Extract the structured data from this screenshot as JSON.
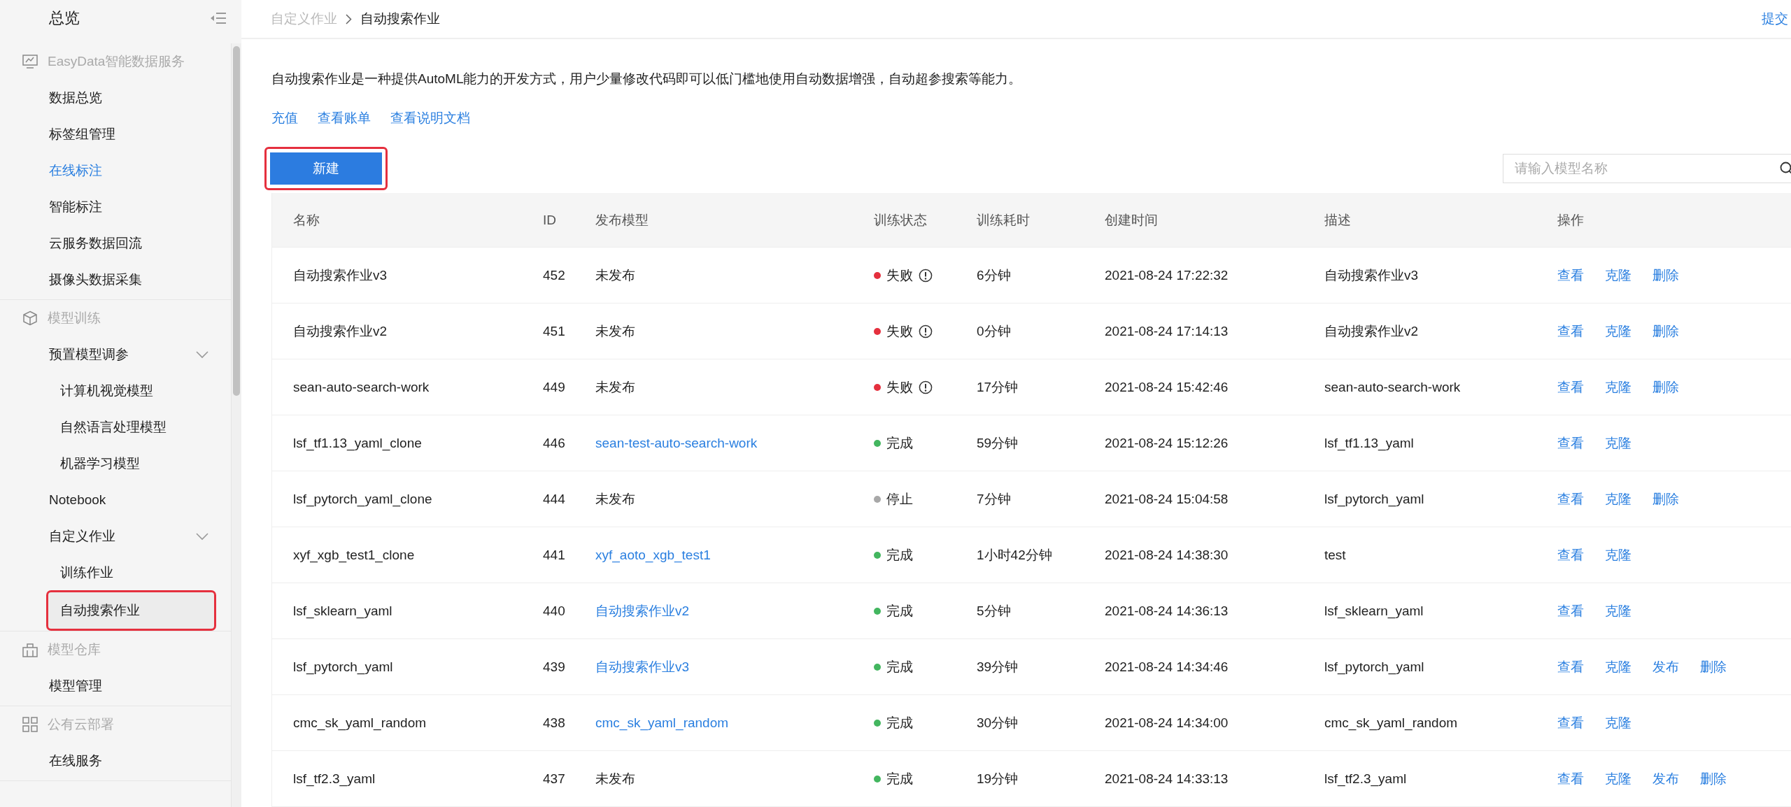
{
  "sidebar": {
    "title": "总览",
    "groups": [
      {
        "title": "EasyData智能数据服务",
        "items": [
          {
            "label": "数据总览",
            "selected": false,
            "hovered": false
          },
          {
            "label": "标签组管理",
            "selected": false,
            "hovered": false
          },
          {
            "label": "在线标注",
            "selected": false,
            "hovered": true
          },
          {
            "label": "智能标注",
            "selected": false,
            "hovered": false
          },
          {
            "label": "云服务数据回流",
            "selected": false,
            "hovered": false
          },
          {
            "label": "摄像头数据采集",
            "selected": false,
            "hovered": false
          }
        ]
      },
      {
        "title": "模型训练",
        "items": [
          {
            "label": "预置模型调参",
            "selected": false,
            "hovered": false,
            "expanded": true,
            "children": [
              {
                "label": "计算机视觉模型",
                "selected": false,
                "hovered": false
              },
              {
                "label": "自然语言处理模型",
                "selected": false,
                "hovered": false
              },
              {
                "label": "机器学习模型",
                "selected": false,
                "hovered": false
              }
            ]
          },
          {
            "label": "Notebook",
            "selected": false,
            "hovered": false
          },
          {
            "label": "自定义作业",
            "selected": false,
            "hovered": false,
            "expanded": true,
            "children": [
              {
                "label": "训练作业",
                "selected": false,
                "hovered": false
              },
              {
                "label": "自动搜索作业",
                "selected": true,
                "hovered": false
              }
            ]
          }
        ]
      },
      {
        "title": "模型仓库",
        "items": [
          {
            "label": "模型管理",
            "selected": false,
            "hovered": false
          }
        ]
      },
      {
        "title": "公有云部署",
        "items": [
          {
            "label": "在线服务",
            "selected": false,
            "hovered": false
          }
        ]
      }
    ]
  },
  "breadcrumb": [
    "自定义作业",
    "自动搜索作业"
  ],
  "top_action": "提交",
  "description": "自动搜索作业是一种提供AutoML能力的开发方式，用户少量修改代码即可以低门槛地使用自动数据增强，自动超参搜索等能力。",
  "links": [
    "充值",
    "查看账单",
    "查看说明文档"
  ],
  "new_button": {
    "label": "新建",
    "highlighted": true
  },
  "search": {
    "placeholder": "请输入模型名称"
  },
  "table": {
    "columns": [
      "名称",
      "ID",
      "发布模型",
      "训练状态",
      "训练耗时",
      "创建时间",
      "描述",
      "操作"
    ],
    "rows": [
      {
        "name": "自动搜索作业v3",
        "id": "452",
        "model": {
          "text": "未发布",
          "link": false
        },
        "status": {
          "label": "失败",
          "kind": "failed"
        },
        "duration": "6分钟",
        "created": "2021-08-24 17:22:32",
        "description": "自动搜索作业v3",
        "actions": [
          "查看",
          "克隆",
          "删除"
        ]
      },
      {
        "name": "自动搜索作业v2",
        "id": "451",
        "model": {
          "text": "未发布",
          "link": false
        },
        "status": {
          "label": "失败",
          "kind": "failed"
        },
        "duration": "0分钟",
        "created": "2021-08-24 17:14:13",
        "description": "自动搜索作业v2",
        "actions": [
          "查看",
          "克隆",
          "删除"
        ]
      },
      {
        "name": "sean-auto-search-work",
        "id": "449",
        "model": {
          "text": "未发布",
          "link": false
        },
        "status": {
          "label": "失败",
          "kind": "failed"
        },
        "duration": "17分钟",
        "created": "2021-08-24 15:42:46",
        "description": "sean-auto-search-work",
        "actions": [
          "查看",
          "克隆",
          "删除"
        ]
      },
      {
        "name": "lsf_tf1.13_yaml_clone",
        "id": "446",
        "model": {
          "text": "sean-test-auto-search-work",
          "link": true
        },
        "status": {
          "label": "完成",
          "kind": "done"
        },
        "duration": "59分钟",
        "created": "2021-08-24 15:12:26",
        "description": "lsf_tf1.13_yaml",
        "actions": [
          "查看",
          "克隆"
        ]
      },
      {
        "name": "lsf_pytorch_yaml_clone",
        "id": "444",
        "model": {
          "text": "未发布",
          "link": false
        },
        "status": {
          "label": "停止",
          "kind": "stopped"
        },
        "duration": "7分钟",
        "created": "2021-08-24 15:04:58",
        "description": "lsf_pytorch_yaml",
        "actions": [
          "查看",
          "克隆",
          "删除"
        ]
      },
      {
        "name": "xyf_xgb_test1_clone",
        "id": "441",
        "model": {
          "text": "xyf_aoto_xgb_test1",
          "link": true
        },
        "status": {
          "label": "完成",
          "kind": "done"
        },
        "duration": "1小时42分钟",
        "created": "2021-08-24 14:38:30",
        "description": "test",
        "actions": [
          "查看",
          "克隆"
        ]
      },
      {
        "name": "lsf_sklearn_yaml",
        "id": "440",
        "model": {
          "text": "自动搜索作业v2",
          "link": true
        },
        "status": {
          "label": "完成",
          "kind": "done"
        },
        "duration": "5分钟",
        "created": "2021-08-24 14:36:13",
        "description": "lsf_sklearn_yaml",
        "actions": [
          "查看",
          "克隆"
        ]
      },
      {
        "name": "lsf_pytorch_yaml",
        "id": "439",
        "model": {
          "text": "自动搜索作业v3",
          "link": true
        },
        "status": {
          "label": "完成",
          "kind": "done"
        },
        "duration": "39分钟",
        "created": "2021-08-24 14:34:46",
        "description": "lsf_pytorch_yaml",
        "actions": [
          "查看",
          "克隆",
          "发布",
          "删除"
        ]
      },
      {
        "name": "cmc_sk_yaml_random",
        "id": "438",
        "model": {
          "text": "cmc_sk_yaml_random",
          "link": true
        },
        "status": {
          "label": "完成",
          "kind": "done"
        },
        "duration": "30分钟",
        "created": "2021-08-24 14:34:00",
        "description": "cmc_sk_yaml_random",
        "actions": [
          "查看",
          "克隆"
        ]
      },
      {
        "name": "lsf_tf2.3_yaml",
        "id": "437",
        "model": {
          "text": "未发布",
          "link": false
        },
        "status": {
          "label": "完成",
          "kind": "done"
        },
        "duration": "19分钟",
        "created": "2021-08-24 14:33:13",
        "description": "lsf_tf2.3_yaml",
        "actions": [
          "查看",
          "克隆",
          "发布",
          "删除"
        ]
      }
    ]
  }
}
